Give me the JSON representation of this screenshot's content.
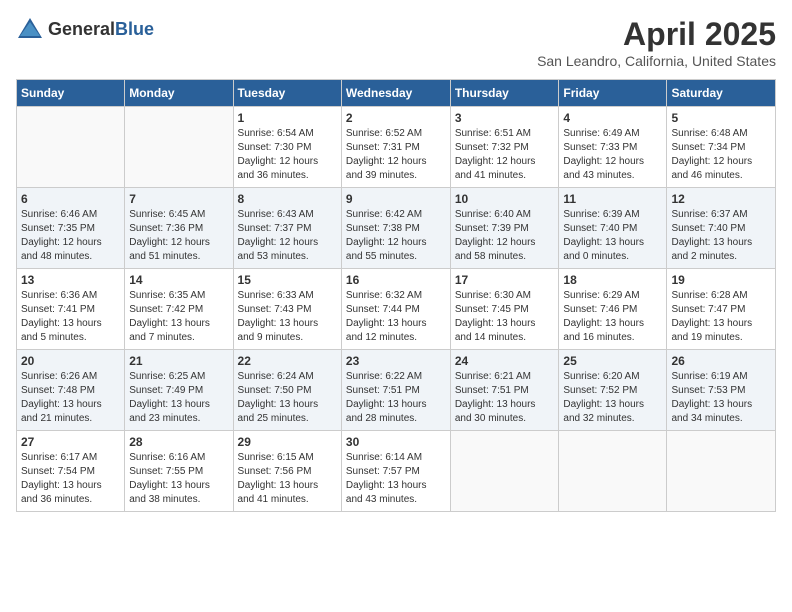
{
  "header": {
    "logo_general": "General",
    "logo_blue": "Blue",
    "month": "April 2025",
    "location": "San Leandro, California, United States"
  },
  "days_of_week": [
    "Sunday",
    "Monday",
    "Tuesday",
    "Wednesday",
    "Thursday",
    "Friday",
    "Saturday"
  ],
  "weeks": [
    [
      {
        "day": "",
        "info": ""
      },
      {
        "day": "",
        "info": ""
      },
      {
        "day": "1",
        "info": "Sunrise: 6:54 AM\nSunset: 7:30 PM\nDaylight: 12 hours\nand 36 minutes."
      },
      {
        "day": "2",
        "info": "Sunrise: 6:52 AM\nSunset: 7:31 PM\nDaylight: 12 hours\nand 39 minutes."
      },
      {
        "day": "3",
        "info": "Sunrise: 6:51 AM\nSunset: 7:32 PM\nDaylight: 12 hours\nand 41 minutes."
      },
      {
        "day": "4",
        "info": "Sunrise: 6:49 AM\nSunset: 7:33 PM\nDaylight: 12 hours\nand 43 minutes."
      },
      {
        "day": "5",
        "info": "Sunrise: 6:48 AM\nSunset: 7:34 PM\nDaylight: 12 hours\nand 46 minutes."
      }
    ],
    [
      {
        "day": "6",
        "info": "Sunrise: 6:46 AM\nSunset: 7:35 PM\nDaylight: 12 hours\nand 48 minutes."
      },
      {
        "day": "7",
        "info": "Sunrise: 6:45 AM\nSunset: 7:36 PM\nDaylight: 12 hours\nand 51 minutes."
      },
      {
        "day": "8",
        "info": "Sunrise: 6:43 AM\nSunset: 7:37 PM\nDaylight: 12 hours\nand 53 minutes."
      },
      {
        "day": "9",
        "info": "Sunrise: 6:42 AM\nSunset: 7:38 PM\nDaylight: 12 hours\nand 55 minutes."
      },
      {
        "day": "10",
        "info": "Sunrise: 6:40 AM\nSunset: 7:39 PM\nDaylight: 12 hours\nand 58 minutes."
      },
      {
        "day": "11",
        "info": "Sunrise: 6:39 AM\nSunset: 7:40 PM\nDaylight: 13 hours\nand 0 minutes."
      },
      {
        "day": "12",
        "info": "Sunrise: 6:37 AM\nSunset: 7:40 PM\nDaylight: 13 hours\nand 2 minutes."
      }
    ],
    [
      {
        "day": "13",
        "info": "Sunrise: 6:36 AM\nSunset: 7:41 PM\nDaylight: 13 hours\nand 5 minutes."
      },
      {
        "day": "14",
        "info": "Sunrise: 6:35 AM\nSunset: 7:42 PM\nDaylight: 13 hours\nand 7 minutes."
      },
      {
        "day": "15",
        "info": "Sunrise: 6:33 AM\nSunset: 7:43 PM\nDaylight: 13 hours\nand 9 minutes."
      },
      {
        "day": "16",
        "info": "Sunrise: 6:32 AM\nSunset: 7:44 PM\nDaylight: 13 hours\nand 12 minutes."
      },
      {
        "day": "17",
        "info": "Sunrise: 6:30 AM\nSunset: 7:45 PM\nDaylight: 13 hours\nand 14 minutes."
      },
      {
        "day": "18",
        "info": "Sunrise: 6:29 AM\nSunset: 7:46 PM\nDaylight: 13 hours\nand 16 minutes."
      },
      {
        "day": "19",
        "info": "Sunrise: 6:28 AM\nSunset: 7:47 PM\nDaylight: 13 hours\nand 19 minutes."
      }
    ],
    [
      {
        "day": "20",
        "info": "Sunrise: 6:26 AM\nSunset: 7:48 PM\nDaylight: 13 hours\nand 21 minutes."
      },
      {
        "day": "21",
        "info": "Sunrise: 6:25 AM\nSunset: 7:49 PM\nDaylight: 13 hours\nand 23 minutes."
      },
      {
        "day": "22",
        "info": "Sunrise: 6:24 AM\nSunset: 7:50 PM\nDaylight: 13 hours\nand 25 minutes."
      },
      {
        "day": "23",
        "info": "Sunrise: 6:22 AM\nSunset: 7:51 PM\nDaylight: 13 hours\nand 28 minutes."
      },
      {
        "day": "24",
        "info": "Sunrise: 6:21 AM\nSunset: 7:51 PM\nDaylight: 13 hours\nand 30 minutes."
      },
      {
        "day": "25",
        "info": "Sunrise: 6:20 AM\nSunset: 7:52 PM\nDaylight: 13 hours\nand 32 minutes."
      },
      {
        "day": "26",
        "info": "Sunrise: 6:19 AM\nSunset: 7:53 PM\nDaylight: 13 hours\nand 34 minutes."
      }
    ],
    [
      {
        "day": "27",
        "info": "Sunrise: 6:17 AM\nSunset: 7:54 PM\nDaylight: 13 hours\nand 36 minutes."
      },
      {
        "day": "28",
        "info": "Sunrise: 6:16 AM\nSunset: 7:55 PM\nDaylight: 13 hours\nand 38 minutes."
      },
      {
        "day": "29",
        "info": "Sunrise: 6:15 AM\nSunset: 7:56 PM\nDaylight: 13 hours\nand 41 minutes."
      },
      {
        "day": "30",
        "info": "Sunrise: 6:14 AM\nSunset: 7:57 PM\nDaylight: 13 hours\nand 43 minutes."
      },
      {
        "day": "",
        "info": ""
      },
      {
        "day": "",
        "info": ""
      },
      {
        "day": "",
        "info": ""
      }
    ]
  ]
}
